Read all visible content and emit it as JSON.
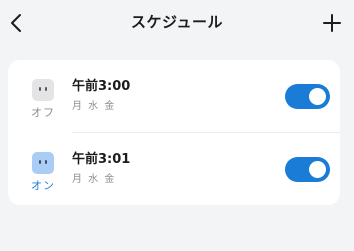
{
  "header": {
    "title": "スケジュール",
    "back_icon": "chevron-left-icon",
    "add_icon": "plus-icon"
  },
  "schedules": [
    {
      "status": "オフ",
      "time": "午前3:00",
      "days": "月 水 金",
      "enabled": true,
      "icon": "plug-icon"
    },
    {
      "status": "オン",
      "time": "午前3:01",
      "days": "月 水 金",
      "enabled": true,
      "icon": "plug-icon"
    }
  ],
  "colors": {
    "accent": "#1a7cd6",
    "status_on": "#1f7fd4",
    "status_off": "#8e8e93",
    "background": "#f3f4f6",
    "card": "#ffffff"
  }
}
